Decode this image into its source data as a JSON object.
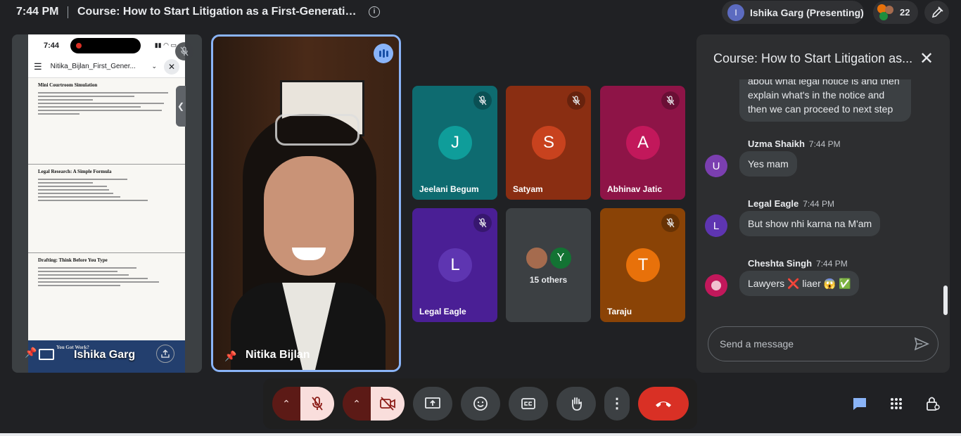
{
  "topbar": {
    "time": "7:44 PM",
    "meeting_title": "Course: How to Start Litigation as a First-Generatio...",
    "presenter_initial": "I",
    "presenter_label": "Ishika Garg (Presenting)",
    "participant_count": "22"
  },
  "screen_share": {
    "phone_time": "7:44",
    "file_name": "Nitika_Bijlan_First_Gener...",
    "page1_heading": "Mini Courtroom Simulation",
    "page2_heading": "Legal Research: A Simple Formula",
    "page3_heading": "Drafting: Think Before You Type",
    "page4_heading": "You Got Work?",
    "presenter_name": "Ishika Garg"
  },
  "speaker": {
    "name": "Nitika Bijlan"
  },
  "participants": [
    {
      "initial": "J",
      "name": "Jeelani Begum",
      "tile_color": "#0e6b70",
      "avatar_color": "#0f9d9a"
    },
    {
      "initial": "S",
      "name": "Satyam",
      "tile_color": "#8a2e12",
      "avatar_color": "#c8421e"
    },
    {
      "initial": "A",
      "name": "Abhinav Jatic",
      "tile_color": "#8e1447",
      "avatar_color": "#c2185b"
    },
    {
      "initial": "L",
      "name": "Legal Eagle",
      "tile_color": "#4a1f95",
      "avatar_color": "#5e35b1"
    },
    {
      "initial": "T",
      "name": "Taraju",
      "tile_color": "#8a4306",
      "avatar_color": "#e8710a"
    }
  ],
  "others": {
    "avatar_initial": "Y",
    "label": "15 others"
  },
  "chat": {
    "title": "Course: How to Start Litigation as...",
    "partial_message": "about what legal notice is and then explain what's in the notice and then we can proceed to next step",
    "messages": [
      {
        "sender": "Uzma Shaikh",
        "time": "7:44 PM",
        "initial": "U",
        "avatar_color": "#7b3fb0",
        "text": "Yes mam"
      },
      {
        "sender": "Legal Eagle",
        "time": "7:44 PM",
        "initial": "L",
        "avatar_color": "#5e35b1",
        "text": "But show nhi karna na M'am"
      },
      {
        "sender": "Cheshta Singh",
        "time": "7:44 PM",
        "initial": "",
        "avatar_color": "#c2185b",
        "text": "Lawyers ❌ liaer 😱 ✅"
      }
    ],
    "input_placeholder": "Send a message"
  },
  "colors": {
    "background": "#202124",
    "accent": "#8ab4f8",
    "leave": "#d93025"
  }
}
